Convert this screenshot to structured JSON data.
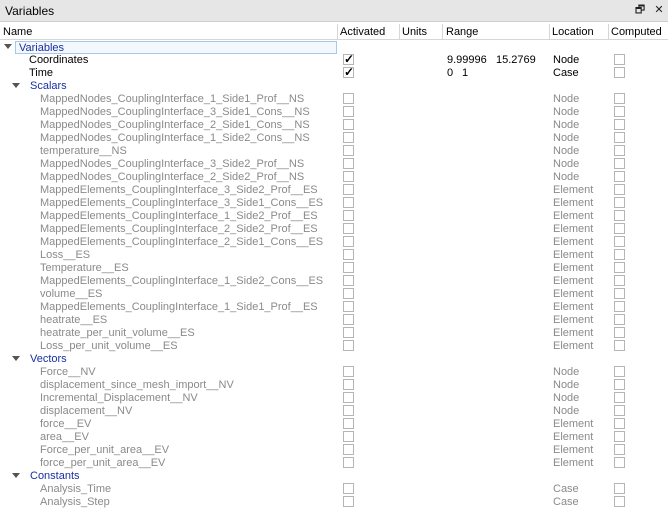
{
  "window": {
    "title": "Variables",
    "restore_glyph": "🗗",
    "close_glyph": "✕"
  },
  "columns": {
    "name": "Name",
    "activated": "Activated",
    "units": "Units",
    "range": "Range",
    "location": "Location",
    "computed": "Computed"
  },
  "root": {
    "label": "Variables"
  },
  "top_items": [
    {
      "name": "Coordinates",
      "activated": true,
      "range_min": "9.99996",
      "range_max": "15.2769",
      "location": "Node"
    },
    {
      "name": "Time",
      "activated": true,
      "range_min": "0",
      "range_max": "1",
      "location": "Case"
    }
  ],
  "groups": [
    {
      "label": "Scalars",
      "items": [
        {
          "name": "MappedNodes_CouplingInterface_1_Side1_Prof__NS",
          "location": "Node"
        },
        {
          "name": "MappedNodes_CouplingInterface_3_Side1_Cons__NS",
          "location": "Node"
        },
        {
          "name": "MappedNodes_CouplingInterface_2_Side1_Cons__NS",
          "location": "Node"
        },
        {
          "name": "MappedNodes_CouplingInterface_1_Side2_Cons__NS",
          "location": "Node"
        },
        {
          "name": "temperature__NS",
          "location": "Node"
        },
        {
          "name": "MappedNodes_CouplingInterface_3_Side2_Prof__NS",
          "location": "Node"
        },
        {
          "name": "MappedNodes_CouplingInterface_2_Side2_Prof__NS",
          "location": "Node"
        },
        {
          "name": "MappedElements_CouplingInterface_3_Side2_Prof__ES",
          "location": "Element"
        },
        {
          "name": "MappedElements_CouplingInterface_3_Side1_Cons__ES",
          "location": "Element"
        },
        {
          "name": "MappedElements_CouplingInterface_1_Side2_Prof__ES",
          "location": "Element"
        },
        {
          "name": "MappedElements_CouplingInterface_2_Side2_Prof__ES",
          "location": "Element"
        },
        {
          "name": "MappedElements_CouplingInterface_2_Side1_Cons__ES",
          "location": "Element"
        },
        {
          "name": "Loss__ES",
          "location": "Element"
        },
        {
          "name": "Temperature__ES",
          "location": "Element"
        },
        {
          "name": "MappedElements_CouplingInterface_1_Side2_Cons__ES",
          "location": "Element"
        },
        {
          "name": "volume__ES",
          "location": "Element"
        },
        {
          "name": "MappedElements_CouplingInterface_1_Side1_Prof__ES",
          "location": "Element"
        },
        {
          "name": "heatrate__ES",
          "location": "Element"
        },
        {
          "name": "heatrate_per_unit_volume__ES",
          "location": "Element"
        },
        {
          "name": "Loss_per_unit_volume__ES",
          "location": "Element"
        }
      ]
    },
    {
      "label": "Vectors",
      "items": [
        {
          "name": "Force__NV",
          "location": "Node"
        },
        {
          "name": "displacement_since_mesh_import__NV",
          "location": "Node"
        },
        {
          "name": "Incremental_Displacement__NV",
          "location": "Node"
        },
        {
          "name": "displacement__NV",
          "location": "Node"
        },
        {
          "name": "force__EV",
          "location": "Element"
        },
        {
          "name": "area__EV",
          "location": "Element"
        },
        {
          "name": "Force_per_unit_area__EV",
          "location": "Element"
        },
        {
          "name": "force_per_unit_area__EV",
          "location": "Element"
        }
      ]
    },
    {
      "label": "Constants",
      "items": [
        {
          "name": "Analysis_Time",
          "location": "Case"
        },
        {
          "name": "Analysis_Step",
          "location": "Case"
        }
      ]
    }
  ]
}
